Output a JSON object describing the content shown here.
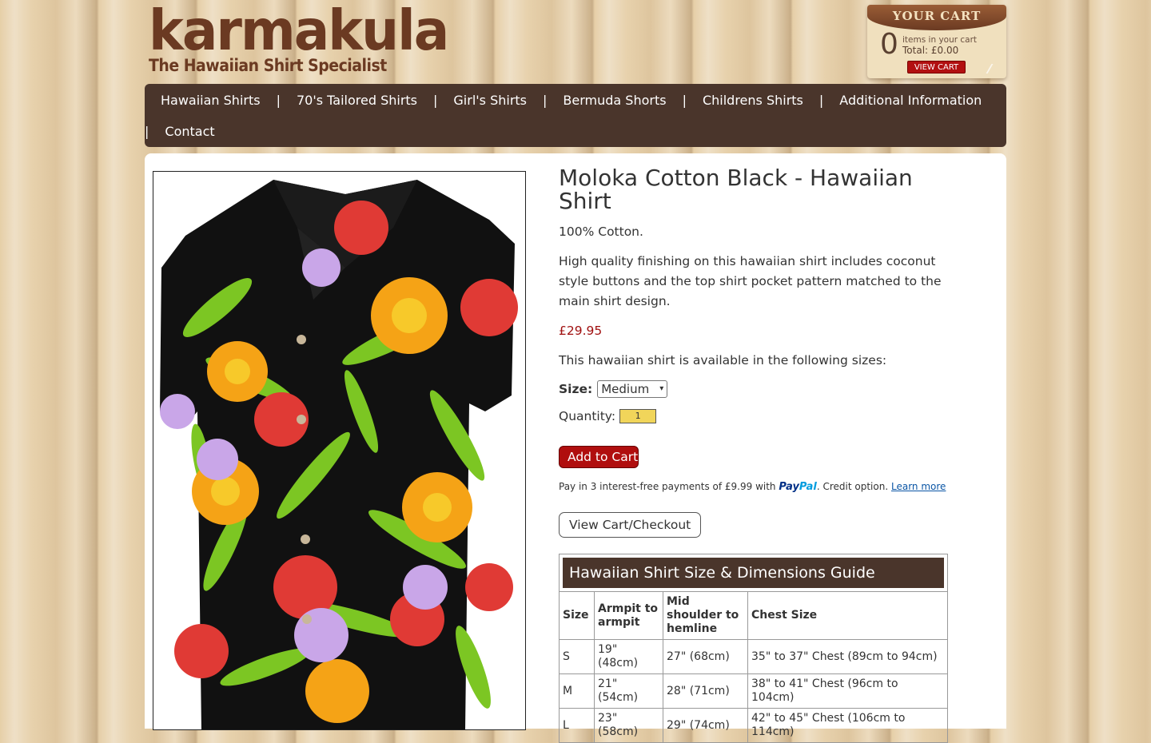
{
  "brand": {
    "logo_word": "karmakula",
    "logo_tagline": "The Hawaiian Shirt Specialist"
  },
  "cart": {
    "banner": "YOUR CART",
    "count": "0",
    "items_label": "items in your cart",
    "total": "Total: £0.00",
    "view_cart": "VIEW CART"
  },
  "nav": {
    "separator": "|",
    "items": [
      "Hawaiian Shirts",
      "70's Tailored Shirts",
      "Girl's Shirts",
      "Bermuda Shorts",
      "Childrens Shirts",
      "Additional Information",
      "Contact"
    ]
  },
  "product": {
    "title": "Moloka Cotton Black - Hawaiian Shirt",
    "material": "100% Cotton.",
    "description": "High quality finishing on this hawaiian shirt includes coconut style buttons and the top shirt pocket pattern matched to the main shirt design.",
    "price": "£29.95",
    "sizes_intro": "This hawaiian shirt is available in the following sizes:",
    "size_label": "Size:",
    "size_selected": "Medium",
    "quantity_label": "Quantity:",
    "quantity_value": "1",
    "add_to_cart": "Add to Cart",
    "paypal_text": "Pay in 3 interest-free payments of £9.99 with",
    "paypal_brand_a": "Pay",
    "paypal_brand_b": "Pal",
    "paypal_after": ". Credit option.",
    "paypal_link": "Learn more",
    "view_checkout": "View Cart/Checkout"
  },
  "size_guide": {
    "caption": "Hawaiian Shirt Size & Dimensions Guide",
    "headers": [
      "Size",
      "Armpit to armpit",
      "Mid shoulder to hemline",
      "Chest Size"
    ],
    "rows": [
      [
        "S",
        "19\" (48cm)",
        "27\" (68cm)",
        "35\" to 37\" Chest (89cm to 94cm)"
      ],
      [
        "M",
        "21\" (54cm)",
        "28\" (71cm)",
        "38\" to 41\" Chest (96cm to 104cm)"
      ],
      [
        "L",
        "23\" (58cm)",
        "29\" (74cm)",
        "42\" to 45\" Chest (106cm to 114cm)"
      ]
    ]
  },
  "colors": {
    "brand_brown": "#6b3a22",
    "nav_bg": "#4a352b",
    "price_red": "#a01010",
    "button_red": "#b00e0e",
    "qty_yellow": "#f1d55a"
  }
}
